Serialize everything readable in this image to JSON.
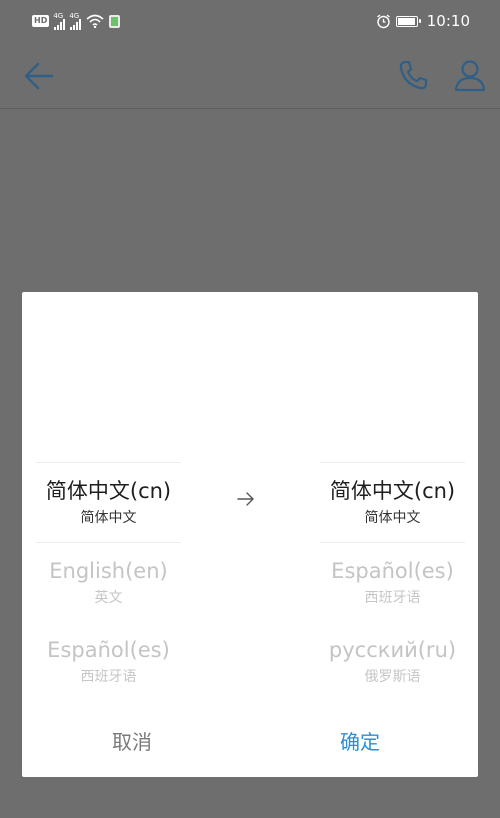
{
  "status_bar": {
    "hd_badge": "HD",
    "signal1_label": "4G",
    "signal2_label": "4G",
    "time": "10:10",
    "icons": [
      "hd-icon",
      "signal-icon",
      "signal-icon",
      "wifi-icon",
      "sim-icon",
      "alarm-icon",
      "battery-icon"
    ]
  },
  "app_bar": {
    "icons": [
      "back-arrow-icon",
      "phone-icon",
      "user-icon"
    ]
  },
  "dialog": {
    "source_languages": [
      {
        "name": "简体中文(cn)",
        "native": "简体中文",
        "selected": true
      },
      {
        "name": "English(en)",
        "native": "英文",
        "selected": false
      },
      {
        "name": "Español(es)",
        "native": "西班牙语",
        "selected": false
      }
    ],
    "target_languages": [
      {
        "name": "简体中文(cn)",
        "native": "简体中文",
        "selected": true
      },
      {
        "name": "Español(es)",
        "native": "西班牙语",
        "selected": false
      },
      {
        "name": "русский(ru)",
        "native": "俄罗斯语",
        "selected": false
      }
    ],
    "arrow_icon": "arrow-right-icon",
    "cancel_label": "取消",
    "confirm_label": "确定"
  },
  "colors": {
    "overlay": "#6e6e6e",
    "accent": "#2d8fd1",
    "dialog_bg": "#ffffff"
  }
}
